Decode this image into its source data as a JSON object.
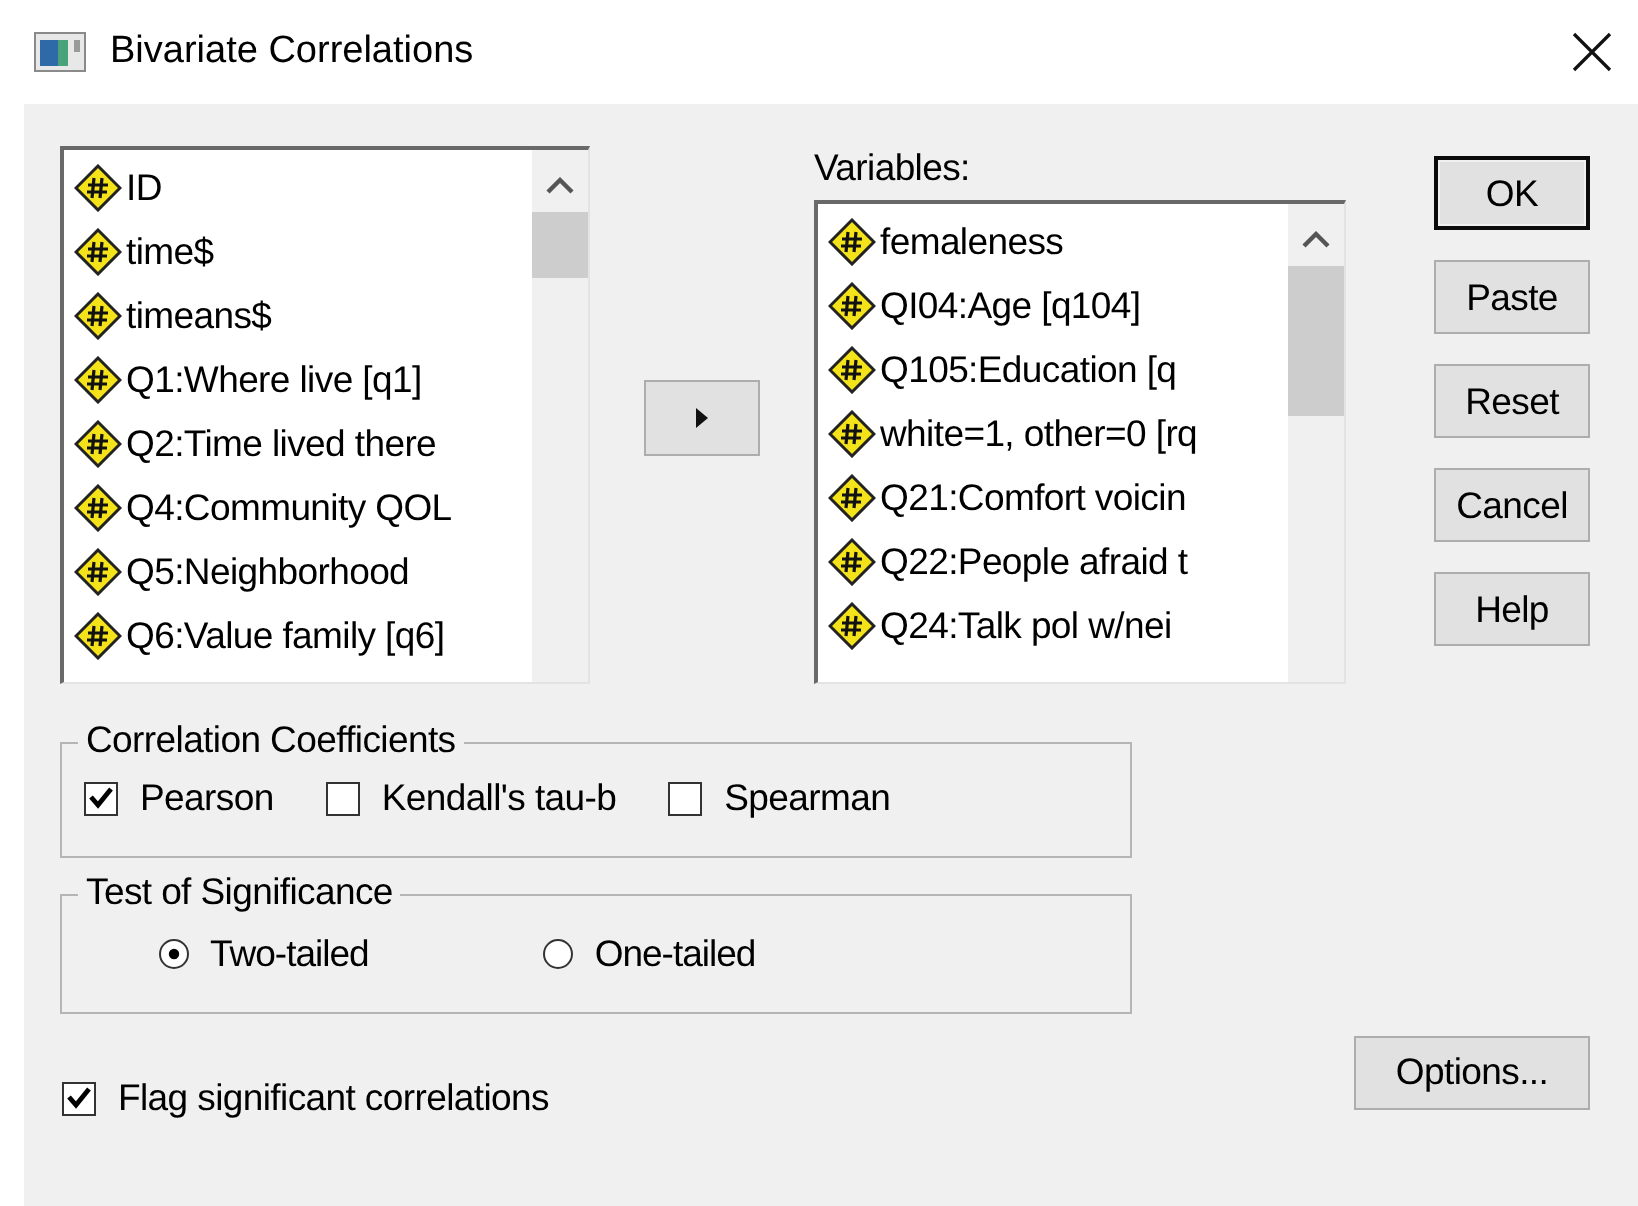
{
  "window": {
    "title": "Bivariate Correlations"
  },
  "source_list": {
    "items": [
      {
        "label": "ID"
      },
      {
        "label": "time$"
      },
      {
        "label": "timeans$"
      },
      {
        "label": "Q1:Where live [q1]"
      },
      {
        "label": "Q2:Time lived there"
      },
      {
        "label": "Q4:Community QOL"
      },
      {
        "label": "Q5:Neighborhood"
      },
      {
        "label": "Q6:Value family [q6]"
      }
    ]
  },
  "variables": {
    "label": "Variables:",
    "items": [
      {
        "label": "femaleness"
      },
      {
        "label": "QI04:Age [q104]"
      },
      {
        "label": "Q105:Education  [q"
      },
      {
        "label": "white=1, other=0 [rq"
      },
      {
        "label": "Q21:Comfort voicin"
      },
      {
        "label": "Q22:People afraid t"
      },
      {
        "label": "Q24:Talk pol w/nei"
      }
    ]
  },
  "buttons": [
    {
      "label": "OK",
      "default": true
    },
    {
      "label": "Paste",
      "default": false
    },
    {
      "label": "Reset",
      "default": false
    },
    {
      "label": "Cancel",
      "default": false
    },
    {
      "label": "Help",
      "default": false
    }
  ],
  "correlation_coefficients": {
    "title": "Correlation Coefficients",
    "options": [
      {
        "label": "Pearson",
        "checked": true
      },
      {
        "label": "Kendall's tau-b",
        "checked": false
      },
      {
        "label": "Spearman",
        "checked": false
      }
    ]
  },
  "test_of_significance": {
    "title": "Test of Significance",
    "options": [
      {
        "label": "Two-tailed",
        "selected": true
      },
      {
        "label": "One-tailed",
        "selected": false
      }
    ]
  },
  "flag_significant": {
    "label": "Flag significant correlations",
    "checked": true
  },
  "options_button": {
    "label": "Options..."
  }
}
